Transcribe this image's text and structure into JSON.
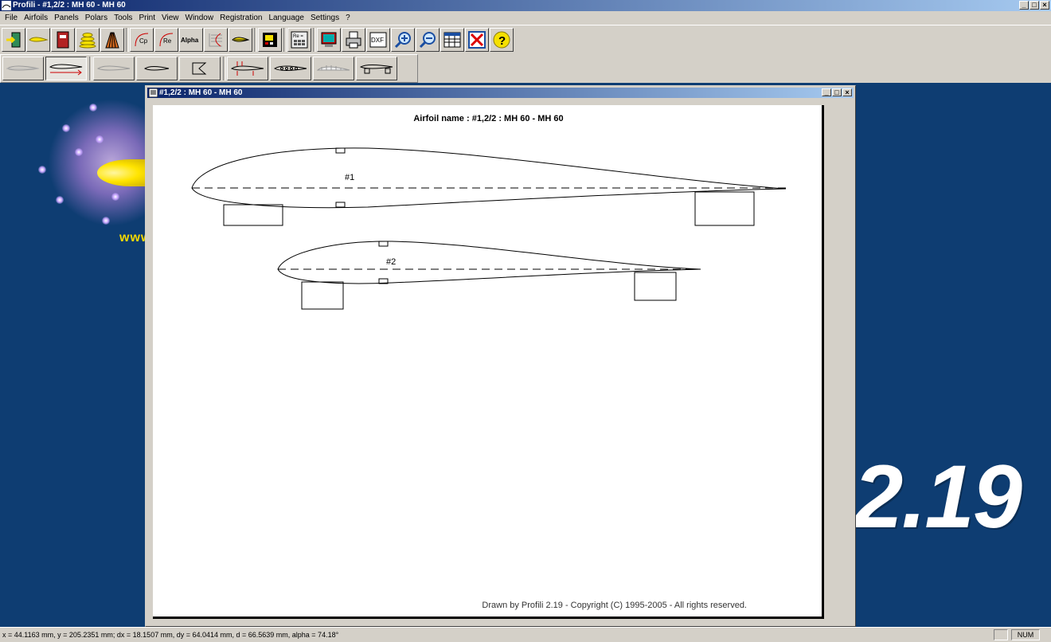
{
  "window": {
    "title": "Profili - #1,2/2 : MH 60 - MH 60",
    "min": "_",
    "max": "□",
    "close": "×"
  },
  "menu": [
    "File",
    "Airfoils",
    "Panels",
    "Polars",
    "Tools",
    "Print",
    "View",
    "Window",
    "Registration",
    "Language",
    "Settings",
    "?"
  ],
  "toolbar1": {
    "icons": [
      "exit-icon",
      "airfoil-icon",
      "book-icon",
      "stack-icon",
      "ribs-icon",
      "cp-polar-icon",
      "re-polar-icon",
      "alpha-polar-icon",
      "polar-curve-icon",
      "airfoil-edit-icon",
      "calc-screen-icon",
      "re-calculator-icon",
      "monitor-icon",
      "printer-icon",
      "dxf-icon",
      "zoom-in-icon",
      "zoom-out-icon",
      "table-icon",
      "close-red-icon",
      "help-icon"
    ],
    "labels": {
      "cp": "Cp",
      "re": "Re",
      "alpha": "Alpha",
      "re_calc": "Re =",
      "dxf": "DXF",
      "help": "?"
    }
  },
  "toolbar2": {
    "icons": [
      "wing-section-icon",
      "wing-section-arrow-icon",
      "airfoil-outline-icon",
      "airfoil-small-icon",
      "template-icon",
      "spar-forces-icon",
      "lightening-holes-icon",
      "sheeting-icon",
      "rib-jig-icon"
    ]
  },
  "splash": {
    "www": "www",
    "version": "2.19"
  },
  "child": {
    "title": "#1,2/2 : MH 60 - MH 60",
    "airfoil_name": "Airfoil name : #1,2/2 : MH 60 - MH 60",
    "label_1": "#1",
    "label_2": "#2",
    "copyright": "Drawn by Profili 2.19 - Copyright (C) 1995-2005 - All rights reserved."
  },
  "status": {
    "coords": "x = 44.1163 mm, y = 205.2351 mm; dx = 18.1507 mm, dy = 64.0414 mm, d = 66.5639 mm, alpha = 74.18°",
    "num": "NUM"
  }
}
